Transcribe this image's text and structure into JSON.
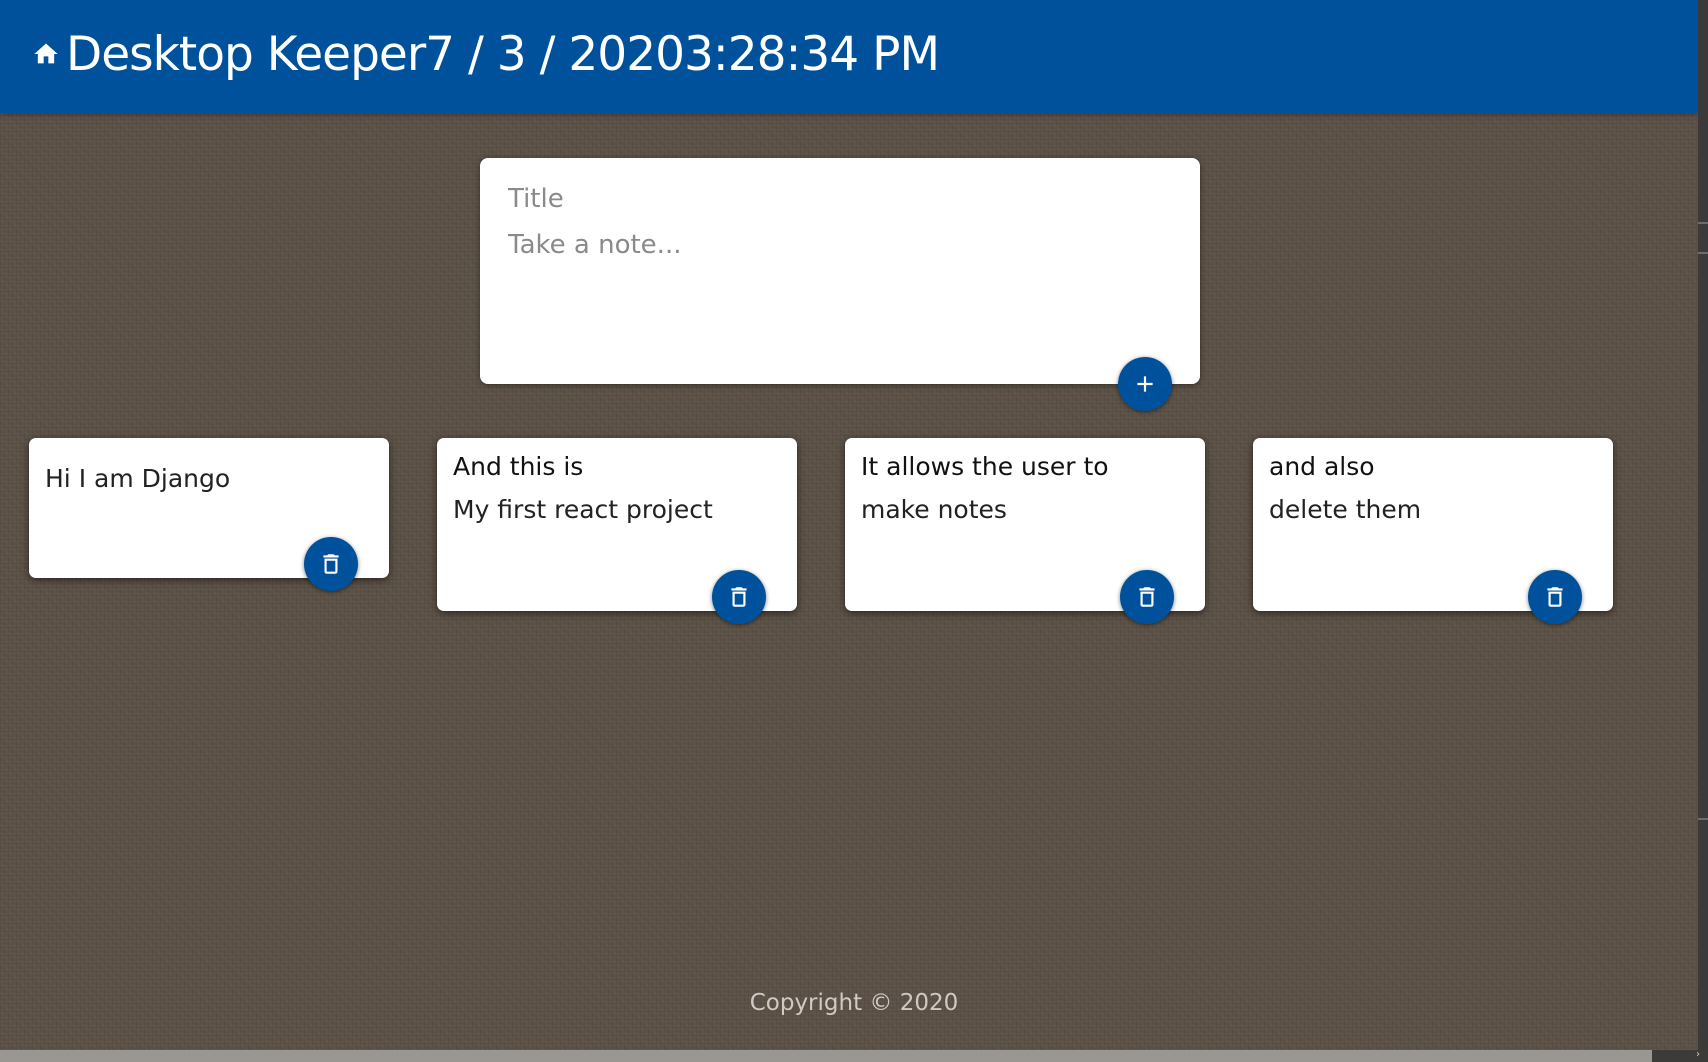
{
  "header": {
    "title": "Desktop Keeper7 / 3 / 20203:28:34 PM",
    "home_icon": "home-icon"
  },
  "create_area": {
    "title_placeholder": "Title",
    "content_placeholder": "Take a note...",
    "add_icon": "plus-icon"
  },
  "notes": [
    {
      "title": "",
      "content": "Hi I am Django"
    },
    {
      "title": "And this is",
      "content": "My first react project"
    },
    {
      "title": "It allows the user to",
      "content": "make notes"
    },
    {
      "title": "and also",
      "content": "delete them"
    }
  ],
  "delete_icon": "trash-icon",
  "footer": {
    "text": "Copyright © 2020"
  },
  "colors": {
    "accent": "#00519b",
    "background": "#5a5045",
    "card": "#ffffff"
  }
}
